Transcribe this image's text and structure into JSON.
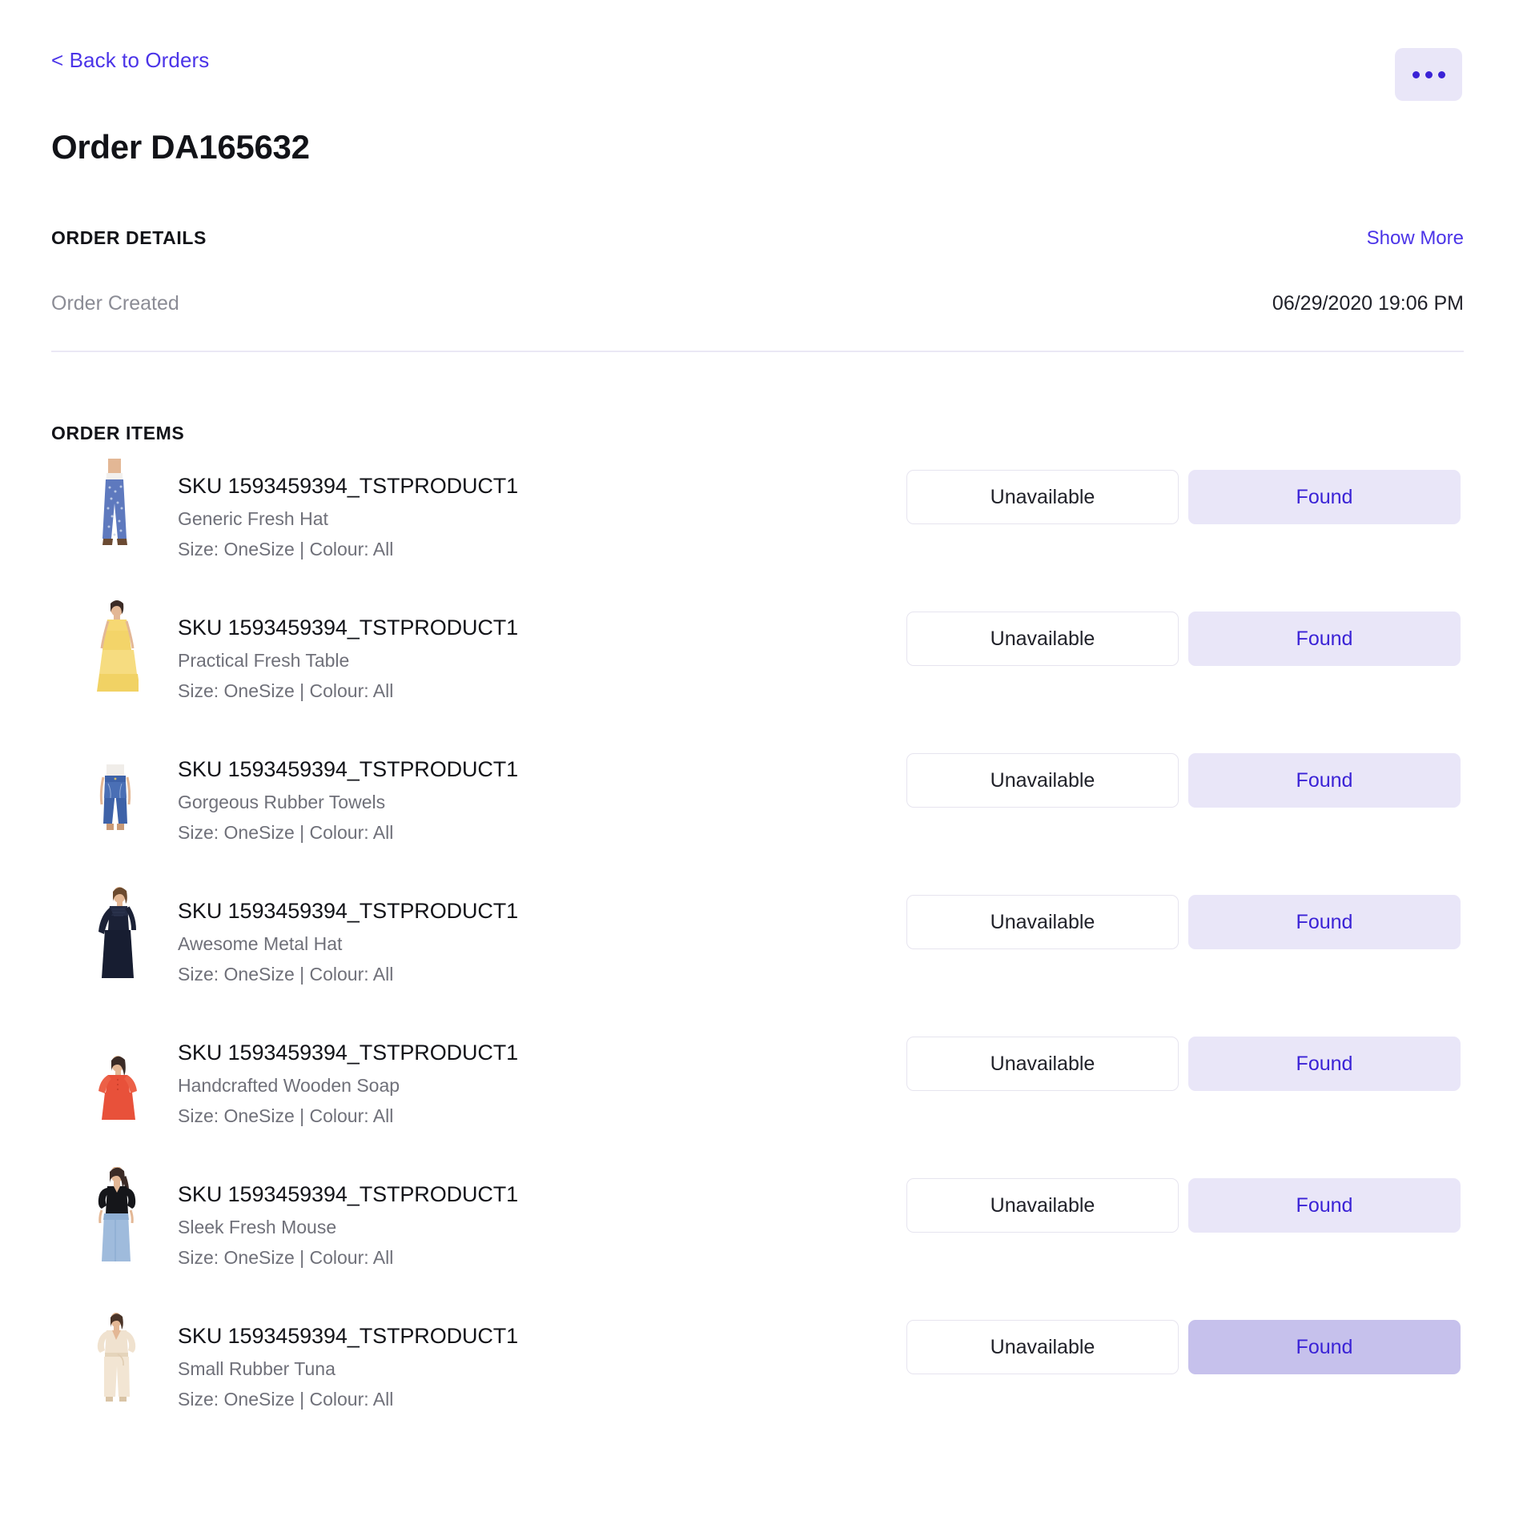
{
  "header": {
    "back_link": "< Back to Orders",
    "kebab_label": "•••",
    "kebab_icon": "ellipsis-horizontal-icon",
    "title": "Order DA165632"
  },
  "order_details": {
    "section_title": "ORDER DETAILS",
    "show_more_label": "Show More",
    "rows": [
      {
        "label": "Order Created",
        "value": "06/29/2020 19:06 PM"
      }
    ]
  },
  "order_items": {
    "section_title": "ORDER ITEMS",
    "buttons": {
      "unavailable_label": "Unavailable",
      "found_label": "Found"
    },
    "items": [
      {
        "sku": "SKU 1593459394_TSTPRODUCT1",
        "name": "Generic Fresh Hat",
        "variant": "Size: OneSize | Colour: All",
        "thumb": "blue-patterned-trousers",
        "found_active": false
      },
      {
        "sku": "SKU 1593459394_TSTPRODUCT1",
        "name": "Practical Fresh Table",
        "variant": "Size: OneSize | Colour: All",
        "thumb": "yellow-maxi-dress",
        "found_active": false
      },
      {
        "sku": "SKU 1593459394_TSTPRODUCT1",
        "name": "Gorgeous Rubber Towels",
        "variant": "Size: OneSize | Colour: All",
        "thumb": "blue-denim-jeans",
        "found_active": false
      },
      {
        "sku": "SKU 1593459394_TSTPRODUCT1",
        "name": "Awesome Metal Hat",
        "variant": "Size: OneSize | Colour: All",
        "thumb": "navy-lace-dress",
        "found_active": false
      },
      {
        "sku": "SKU 1593459394_TSTPRODUCT1",
        "name": "Handcrafted Wooden Soap",
        "variant": "Size: OneSize | Colour: All",
        "thumb": "red-short-dress",
        "found_active": false
      },
      {
        "sku": "SKU 1593459394_TSTPRODUCT1",
        "name": "Sleek Fresh Mouse",
        "variant": "Size: OneSize | Colour: All",
        "thumb": "black-top-blue-jeans",
        "found_active": false
      },
      {
        "sku": "SKU 1593459394_TSTPRODUCT1",
        "name": "Small Rubber Tuna",
        "variant": "Size: OneSize | Colour: All",
        "thumb": "cream-jumpsuit",
        "found_active": true
      }
    ]
  },
  "colors": {
    "accent": "#4B34E8",
    "accent_strong": "#3A22D6",
    "accent_soft": "#E9E6F8",
    "accent_soft_active": "#C6C1EC",
    "text": "#121318",
    "muted": "#6F7079",
    "label_muted": "#8B8C95",
    "border": "#E6E4EF",
    "divider": "#EAE8F5"
  }
}
